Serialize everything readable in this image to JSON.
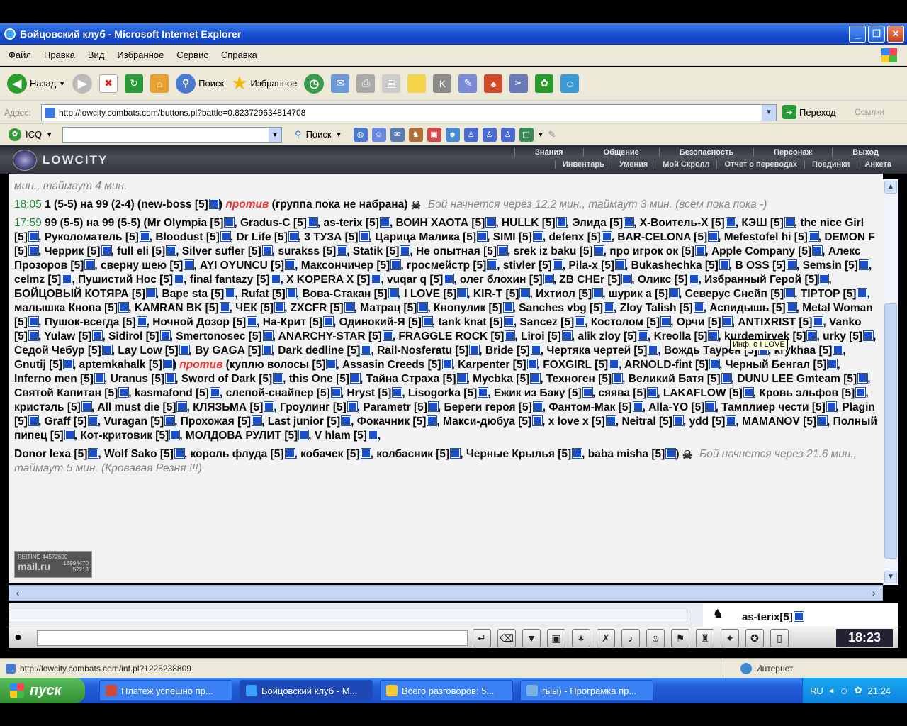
{
  "window": {
    "title": "Бойцовский клуб - Microsoft Internet Explorer"
  },
  "menu": [
    "Файл",
    "Правка",
    "Вид",
    "Избранное",
    "Сервис",
    "Справка"
  ],
  "toolbar": {
    "back": "Назад",
    "search": "Поиск",
    "favorites": "Избранное"
  },
  "address": {
    "label": "Адрес:",
    "url": "http://lowcity.combats.com/buttons.pl?battle=0.823729634814708",
    "go": "Переход",
    "links": "Ссылки"
  },
  "icq": {
    "label": "ICQ",
    "search": "Поиск"
  },
  "site": {
    "logo": "LOWCITY",
    "nav_top": [
      "Знания",
      "Общение",
      "Безопасность",
      "Персонаж",
      "Выход"
    ],
    "nav_bottom": [
      "Инвентарь",
      "Умения",
      "Мой Скролл",
      "Отчет о переводах",
      "Поединки",
      "Анкета"
    ]
  },
  "content": {
    "line0": "мин., таймаут 4 мин.",
    "b1_time": "18:05",
    "b1_pre": "1 (5-5) на 99 (2-4) (new-boss [5]",
    "b1_vs": "против",
    "b1_post": "(группа пока не набрана)",
    "b1_status": "Бой начнется через 12.2 мин., таймаут 3 мин. (всем пока пока -)",
    "b2_time": "17:59",
    "b2_text1": "99 (5-5) на 99 (5-5) (Mr Olympia [5]■, Gradus-C [5]■, as-terix [5]■, ВОИН ХАОТА [5]■, HULLK [5]■, Элида [5]■, X-Воитель-X [5]■, КЭШ [5]■, the nice Girl [5]■, Руколоматель [5]■, Bloodust [5]■, Dr Life [5]■, 3 ТУЗА [5]■, Царица Малика [5]■, SIMI [5]■, defenx [5]■, BAR-CELONA [5]■, Mefestofel hi [5]■, DEMON F [5]■, Черрик [5]■, full eli [5]■, Silver sufler [5]■, surakss [5]■, Statik [5]■, Не опытная [5]■, srek iz baku [5]■, про игрок ок [5]■, Apple Company [5]■, Алекс Прозоров [5]■, сверну шею [5]■, AYI OYUNCU [5]■, Максончичер [5]■, гросмейстр [5]■, stivler [5]■, Pila-x [5]■, Bukashechka [5]■, B OSS [5]■, Semsin [5]■, celmz [5]■, Пушистий Нос [5]■, final fantazy [5]■, X KOPERA X [5]■, vuqar q [5]■, олег блохин [5]■, ZB CHEr [5]■, Оликс [5]■, Избранный Герой [5]■, БОЙЦОВЫЙ КОТЯРА [5]■, Bape sta [5]■, Rufat [5]■, Вова-Стакан [5]■, I LOVE [5]■, KIR-T [5]■, Ихтиол [5]■, шурик а [5]■, Северус Снейп [5]■, TIPTOP [5]■, малышка Кнопа [5]■, KAMRAN BK [5]■, ЧЕК [5]■, ZXCFR [5]■, Матрац [5]■, Кнопулик [5]■, Sanches vbg [5]■, Zloy Talish [5]■, Аспидышь [5]■, Metal Woman [5]■, Пушок-всегда [5]■, Ночной Дозор [5]■, На-Крит [5]■, Одинокий-Я [5]■, tank knat [5]■, Sancez [5]■, Костолом [5]■, Орчи [5]■, ANTIXRIST [5]■, Vanko [5]■, Yulaw [5]■, Sidirol [5]■, Smertonosec [5]■, ANARCHY-STAR [5]■, FRAGGLE ROCK [5]■, Liroi [5]■, alik zloy [5]■, Kreolla [5]■, kurdemiryek [5]■, urky [5]■, Седой Чебур [5]■, Lay Low [5]■, By GAGA [5]■, Dark dedline [5]■, Rail-Nosferatu [5]■, Bride [5]■, Чертяка чертей [5]■, Вождь Таурен [5]■, krykhaa [5]■, Gnutij [5]■, aptemkahalk [5]■)",
    "b2_vs": "против",
    "b2_text2": "(куплю волосы [5]■, Assasin Creeds [5]■, Karpenter [5]■, FOXGIRL [5]■, ARNOLD-fint [5]■, Черный Бенгал [5]■, Inferno men [5]■, Uranus [5]■, Sword of Dark [5]■, this One [5]■, Тайна Страха [5]■, Mycbka [5]■, Техноген [5]■, Великий Батя [5]■, DUNU LEE Gmteam [5]■, Святой Капитан [5]■, kasmafond [5]■, слепой-снайпер [5]■, Hryst [5]■, Lisogorka [5]■, Ежик из Баку [5]■, сяява [5]■, LAKAFLOW [5]■, Кровь эльфов [5]■, кристэль [5]■, All must die [5]■, КЛЯЗЬМА [5]■, Гроулинг [5]■, Parametr [5]■, Береги героя [5]■, Фантом-Мак [5]■, Alla-YO [5]■, Тамплиер чести [5]■, Plagin [5]■, Graff [5]■, Vuragan [5]■, Прохожая [5]■, Last junior [5]■, Фокачник [5]■, Макси-дюбуа [5]■, x love x [5]■, Neitral [5]■, ydd [5]■, MAMANOV [5]■, Полный пипец [5]■, Кот-критовик [5]■, МОЛДОВА РУЛИТ [5]■, V hlam [5]■,",
    "b2_text3": "Donor lexa [5]■, Wolf Sako [5]■, король флуда [5]■, кобачек [5]■, колбасник [5]■, Черные Крылья [5]■, baba misha [5]■)",
    "b2_status": "Бой начнется через 21.6 мин., таймаут 5 мин. (Кровавая Резня !!!)",
    "tooltip": "Инф. о I LOVE",
    "counter_top": "REITING 44572600",
    "counter_brand": "mail.ru",
    "counter_nums": "16994470 52218"
  },
  "chat": {
    "user": "as-terix[5]",
    "clock": "18:23"
  },
  "status": {
    "url": "http://lowcity.combats.com/inf.pl?1225238809",
    "zone": "Интернет"
  },
  "taskbar": {
    "start": "пуск",
    "tasks": [
      "Платеж успешно пр...",
      "Бойцовский клуб - М...",
      "Всего разговоров: 5...",
      "гыы) - Програмка пр..."
    ],
    "lang": "RU",
    "time": "21:24"
  }
}
